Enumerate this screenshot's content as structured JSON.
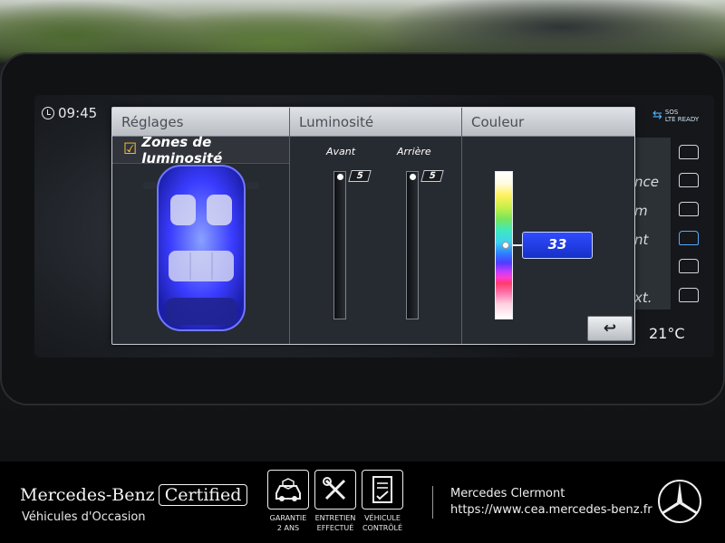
{
  "status": {
    "time": "09:45",
    "sos_top": "SOS",
    "sos_bottom": "LTE READY",
    "temperature": "21°C"
  },
  "side_labels": [
    "nce",
    "m",
    "nt",
    "xt."
  ],
  "dialog": {
    "col1_title": "Réglages",
    "col2_title": "Luminosité",
    "col3_title": "Couleur",
    "zones_checked": true,
    "zones_label": "Zones de luminosité",
    "front_label": "Avant",
    "rear_label": "Arrière",
    "front_value": "5",
    "rear_value": "5",
    "front_level_pct": 100,
    "rear_level_pct": 100,
    "color_value": "33",
    "color_level_pct": 50,
    "back_symbol": "↩"
  },
  "footer": {
    "brand": "Mercedes-Benz",
    "certified": "Certified",
    "subtitle": "Véhicules d'Occasion",
    "badges": [
      {
        "icon": "car-shield-icon",
        "line1": "GARANTIE",
        "line2": "2 ANS"
      },
      {
        "icon": "tools-icon",
        "line1": "ENTRETIEN",
        "line2": "EFFECTUÉ"
      },
      {
        "icon": "checklist-icon",
        "line1": "VÉHICULE",
        "line2": "CONTRÔLÉ"
      }
    ],
    "dealer": "Mercedes Clermont",
    "url": "https://www.cea.mercedes-benz.fr"
  },
  "colors": {
    "accent_blue": "#2f4cff",
    "check_yellow": "#ffcc33",
    "ambient_blue": "#3a3cff"
  }
}
